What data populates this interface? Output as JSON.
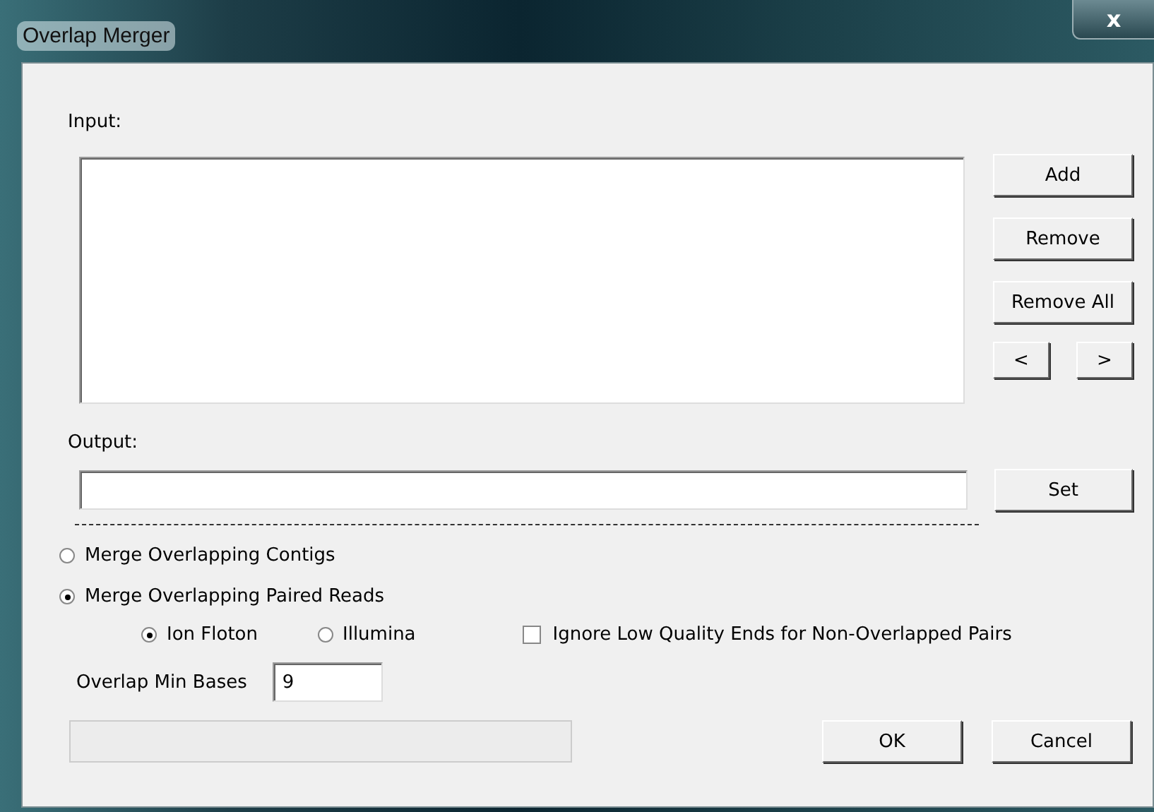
{
  "window": {
    "title": "Overlap Merger",
    "close": "x"
  },
  "input": {
    "label": "Input:"
  },
  "input_buttons": [
    {
      "label": "Add"
    },
    {
      "label": "Remove"
    },
    {
      "label": "Remove All"
    }
  ],
  "nav_buttons": [
    {
      "label": "<"
    },
    {
      "label": ">"
    }
  ],
  "output": {
    "label": "Output:",
    "button": "Set"
  },
  "modes": [
    {
      "label": "Merge Overlapping Contigs",
      "selected": false
    },
    {
      "label": "Merge Overlapping Paired Reads",
      "selected": true
    }
  ],
  "platforms": [
    {
      "label": "Ion Floton",
      "selected": true
    },
    {
      "label": "Illumina",
      "selected": false
    }
  ],
  "ignore_ends": {
    "label": "Ignore Low Quality Ends for Non-Overlapped Pairs",
    "checked": false
  },
  "min_bases": {
    "label": "Overlap Min Bases",
    "value": "9"
  },
  "buttons": [
    {
      "label": "OK"
    },
    {
      "label": "Cancel"
    }
  ]
}
